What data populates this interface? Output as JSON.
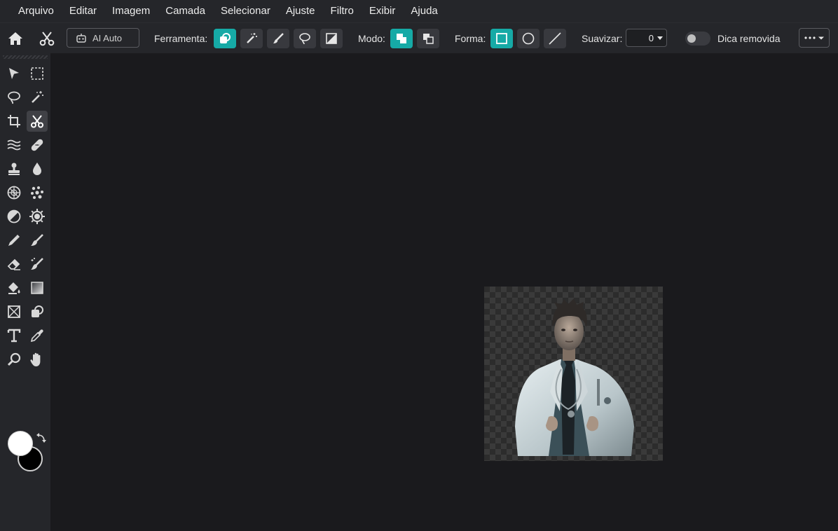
{
  "menu": [
    "Arquivo",
    "Editar",
    "Imagem",
    "Camada",
    "Selecionar",
    "Ajuste",
    "Filtro",
    "Exibir",
    "Ajuda"
  ],
  "options": {
    "ai_label": "AI Auto",
    "tool_label": "Ferramenta:",
    "mode_label": "Modo:",
    "shape_label": "Forma:",
    "smooth_label": "Suavizar:",
    "smooth_value": "0",
    "tip_label": "Dica removida",
    "accent": "#16aaa6"
  },
  "tools": [
    [
      "move-tool",
      "marquee-select-tool"
    ],
    [
      "lasso-tool",
      "magic-wand-tool"
    ],
    [
      "crop-tool",
      "cutout-tool"
    ],
    [
      "liquify-tool",
      "healing-bandage-tool"
    ],
    [
      "clone-stamp-tool",
      "blur-drop-tool"
    ],
    [
      "sponge-tool",
      "pixelate-tool"
    ],
    [
      "dodge-burn-tool",
      "sharpen-tool"
    ],
    [
      "color-picker-tool",
      "brush-tool"
    ],
    [
      "eraser-tool",
      "smart-brush-tool"
    ],
    [
      "paint-bucket-tool",
      "gradient-tool"
    ],
    [
      "frame-tool",
      "shape-tool"
    ],
    [
      "text-tool",
      "eyedropper-tool"
    ],
    [
      "zoom-tool",
      "hand-tool"
    ]
  ],
  "colors": {
    "foreground": "#ffffff",
    "background": "#000000"
  }
}
